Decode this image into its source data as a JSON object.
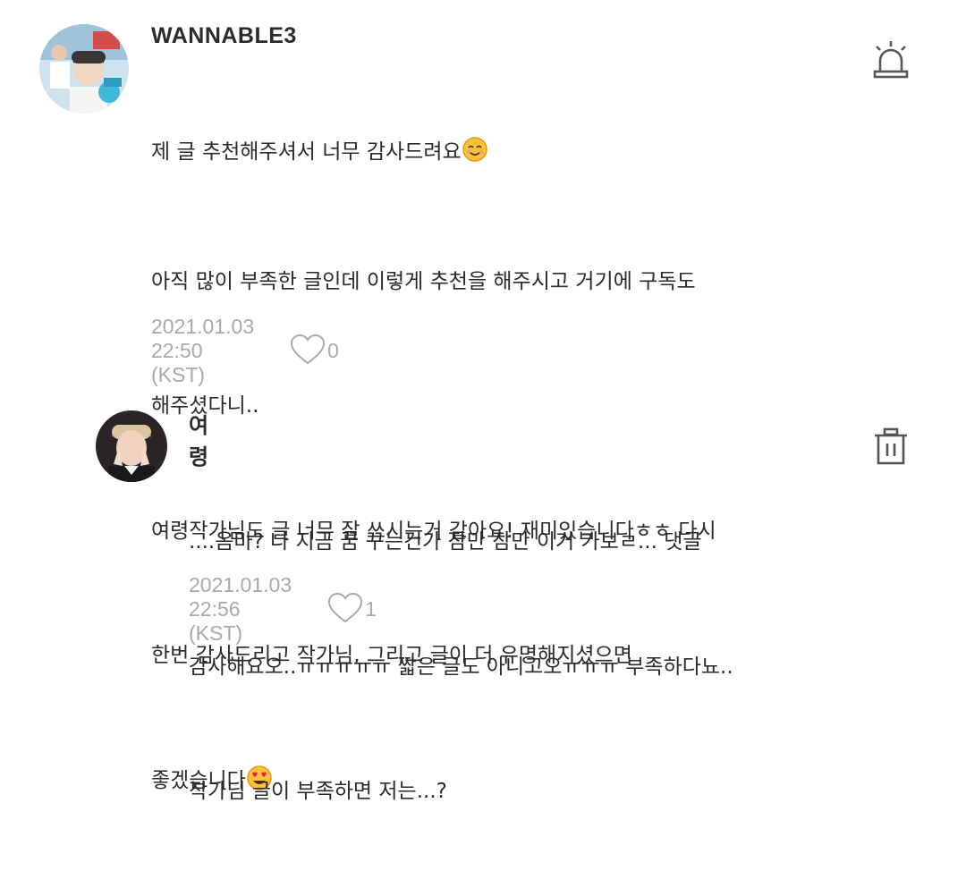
{
  "comments": [
    {
      "username": "WANNABLE3",
      "lines": [
        "제 글 추천해주셔서 너무 감사드려요",
        "아직 많이 부족한 글인데 이렇게 추천을 해주시고 거기에 구독도",
        "해주셨다니..",
        "여령작가님도 글 너무 잘 쓰시는거 같아요! 재미있습니다ㅎㅎ 다시",
        "한번 감사드리고 작가님, 그리고 글이 더 유명해지셨으면",
        "좋겠습니다"
      ],
      "emojis": [
        "smiling-face-emoji",
        "heart-eyes-emoji"
      ],
      "timestamp": "2021.01.03 22:50 (KST)",
      "likes": "0",
      "action_icon": "report-siren-icon"
    },
    {
      "username": "여령",
      "lines": [
        "....옴마? 나 지금 꿈 꾸는건가 잠만 잠만 이거 가보ㄹ... 댓글",
        "감사해요오..ㅠㅠㅠㅠㅠ 짧은 글도 아니고오ㅠㅠㅠ 부족하다뇨..",
        "작가님 글이 부족하면 저는...?"
      ],
      "timestamp": "2021.01.03 22:56 (KST)",
      "likes": "1",
      "action_icon": "trash-icon"
    }
  ],
  "colors": {
    "text": "#2a2a2a",
    "meta": "#a9a9a9",
    "icon": "#555555"
  }
}
